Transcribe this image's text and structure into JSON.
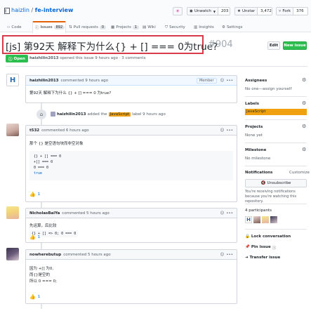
{
  "repo": {
    "owner": "haizlin",
    "separator": "/",
    "name": "fe-interview"
  },
  "header": {
    "unwatch_label": "Unwatch",
    "unwatch_count": "203",
    "unstar_label": "Unstar",
    "unstar_count": "3,472",
    "fork_label": "Fork",
    "fork_count": "376"
  },
  "tabs": [
    {
      "label": "Code"
    },
    {
      "label": "Issues",
      "count": "892"
    },
    {
      "label": "Pull requests",
      "count": "0"
    },
    {
      "label": "Projects",
      "count": "1"
    },
    {
      "label": "Wiki"
    },
    {
      "label": "Security"
    },
    {
      "label": "Insights"
    },
    {
      "label": "Settings"
    }
  ],
  "issue": {
    "title": "[js] 第92天 解释下为什么{} + [] === 0为true?",
    "number": "#904",
    "state": "Open",
    "author": "haizhilin2013",
    "meta": "opened this issue 9 hours ago · 3 comments",
    "edit_label": "Edit",
    "new_issue_label": "New issue"
  },
  "comments": [
    {
      "author": "haizhilin2013",
      "time": "commented 9 hours ago",
      "badge": "Member",
      "body": "第92天 解释下为什么 {} + [] === 0 为true?"
    },
    {
      "author": "t532",
      "time": "commented 6 hours ago",
      "body": "那个 {} 是空语句块而非空对象",
      "code": [
        "{} + [] === 0",
        "+[] === 0",
        "0 === 0",
        "true"
      ],
      "reaction": "1"
    },
    {
      "author": "NicholasBaiYa",
      "time": "commented 5 hours ago",
      "body": "先运算，后比较",
      "code": [
        "{} + [] => 0; 0 === 0"
      ],
      "reaction": "1"
    },
    {
      "author": "nowherebutup",
      "time": "commented 5 hours ago",
      "body_lines": [
        "因为 +[] 为0,",
        "而{}是空的",
        "所以 0 === 0;"
      ],
      "reaction": "1"
    }
  ],
  "event": {
    "author": "haizhilin2013",
    "before": "added the",
    "label": "JavaScript",
    "after": "label 9 hours ago"
  },
  "sidebar": {
    "assignees_title": "Assignees",
    "assignees_value": "No one—assign yourself",
    "labels_title": "Labels",
    "label": "JavaScript",
    "projects_title": "Projects",
    "projects_value": "None yet",
    "milestone_title": "Milestone",
    "milestone_value": "No milestone",
    "notifications_title": "Notifications",
    "customize_label": "Customize",
    "unsubscribe_label": "Unsubscribe",
    "notifications_note": "You're receiving notifications because you're watching this repository.",
    "participants": "4 participants",
    "lock": "Lock conversation",
    "pin": "Pin issue",
    "transfer": "Transfer issue"
  },
  "colors": {
    "accent": "#0366d6",
    "open_green": "#28a745",
    "label_orange": "#f1a10f",
    "highlight_red": "#d73a49"
  }
}
